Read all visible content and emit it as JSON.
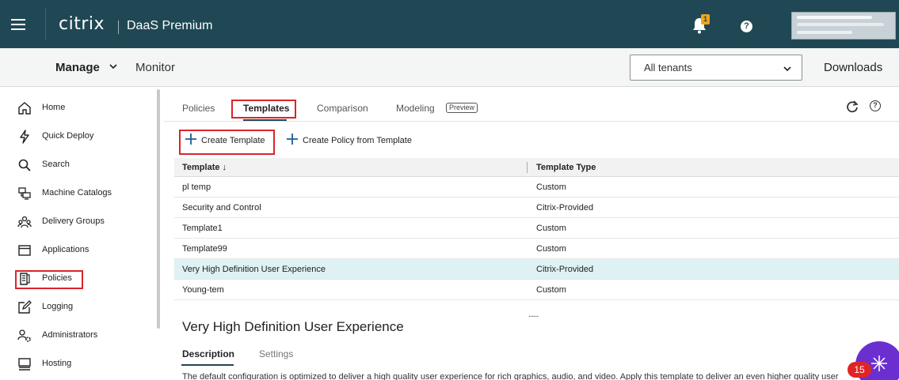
{
  "header": {
    "brand": "citrix",
    "product": "DaaS Premium",
    "notification_count": "1",
    "help_glyph": "?"
  },
  "subbar": {
    "manage_label": "Manage",
    "monitor_label": "Monitor",
    "tenant_value": "All tenants",
    "downloads_label": "Downloads"
  },
  "sidebar": {
    "items": [
      {
        "label": "Home",
        "icon": "home-icon"
      },
      {
        "label": "Quick Deploy",
        "icon": "lightning-icon"
      },
      {
        "label": "Search",
        "icon": "search-icon"
      },
      {
        "label": "Machine Catalogs",
        "icon": "machine-catalogs-icon"
      },
      {
        "label": "Delivery Groups",
        "icon": "delivery-groups-icon"
      },
      {
        "label": "Applications",
        "icon": "applications-icon"
      },
      {
        "label": "Policies",
        "icon": "policies-icon"
      },
      {
        "label": "Logging",
        "icon": "logging-icon"
      },
      {
        "label": "Administrators",
        "icon": "administrators-icon"
      },
      {
        "label": "Hosting",
        "icon": "hosting-icon"
      }
    ]
  },
  "main": {
    "tabs": [
      {
        "label": "Policies"
      },
      {
        "label": "Templates"
      },
      {
        "label": "Comparison"
      },
      {
        "label": "Modeling"
      }
    ],
    "preview_chip": "Preview",
    "actions": {
      "create_template": "Create Template",
      "create_policy_from_template": "Create Policy from Template"
    },
    "table": {
      "columns": [
        "Template ↓",
        "Template Type"
      ],
      "rows": [
        {
          "name": "pl temp",
          "type": "Custom"
        },
        {
          "name": "Security and Control",
          "type": "Citrix-Provided"
        },
        {
          "name": "Template1",
          "type": "Custom"
        },
        {
          "name": "Template99",
          "type": "Custom"
        },
        {
          "name": "Very High Definition User Experience",
          "type": "Citrix-Provided"
        },
        {
          "name": "Young-tem",
          "type": "Custom"
        }
      ],
      "selected_row": 4
    },
    "resize_handle": "......",
    "detail": {
      "title": "Very High Definition User Experience",
      "tabs": [
        "Description",
        "Settings"
      ],
      "description": "The default configuration is optimized to deliver a high quality user experience for rich graphics, audio, and video. Apply this template to deliver an even higher quality user"
    }
  },
  "chat": {
    "badge_count": "15"
  },
  "colors": {
    "header_bg": "#1f4854",
    "highlight_red": "#d9252b",
    "selected_row": "#def1f3",
    "badge_orange": "#f2a51a",
    "chat_purple": "#6b2fd0"
  }
}
